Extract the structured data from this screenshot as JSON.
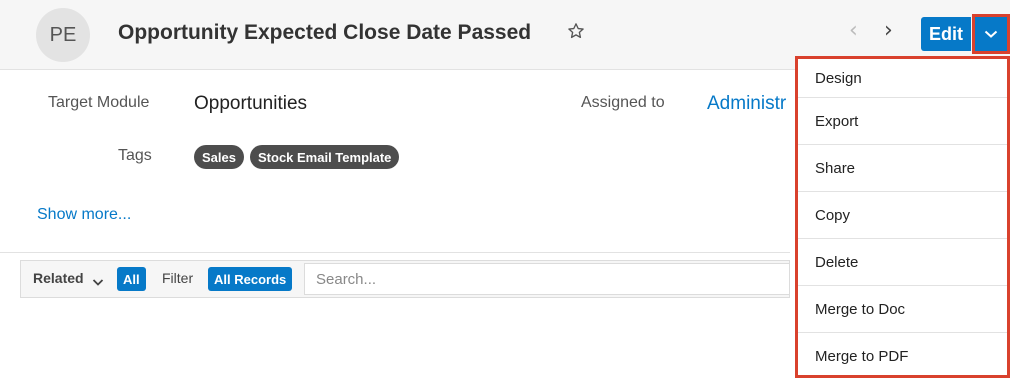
{
  "header": {
    "avatar_initials": "PE",
    "title": "Opportunity Expected Close Date Passed",
    "star_icon": "star-outline-icon",
    "edit_label": "Edit",
    "accent_color": "#0679c8",
    "highlight_color": "#d9412d"
  },
  "fields": {
    "target_module_label": "Target Module",
    "target_module_value": "Opportunities",
    "assigned_to_label": "Assigned to",
    "assigned_to_value": "Administra",
    "tags_label": "Tags",
    "tags": [
      "Sales",
      "Stock Email Template"
    ]
  },
  "show_more": "Show more...",
  "subpanel": {
    "related_label": "Related",
    "related_value": "All",
    "filter_label": "Filter",
    "filter_value": "All Records",
    "search_placeholder": "Search..."
  },
  "menu": {
    "items": [
      "Design",
      "Export",
      "Share",
      "Copy",
      "Delete",
      "Merge to Doc",
      "Merge to PDF"
    ]
  }
}
